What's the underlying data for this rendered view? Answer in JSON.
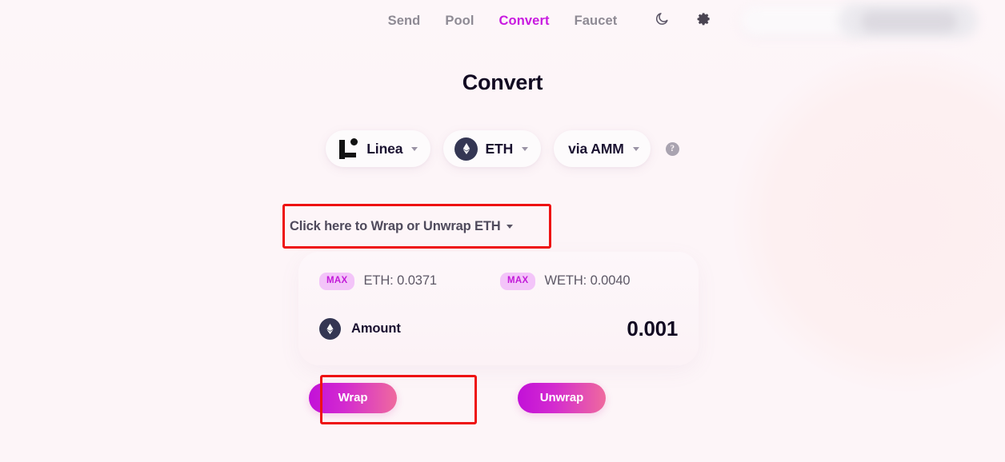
{
  "nav": {
    "items": [
      {
        "label": "Send",
        "active": false
      },
      {
        "label": "Pool",
        "active": false
      },
      {
        "label": "Convert",
        "active": true
      },
      {
        "label": "Faucet",
        "active": false
      }
    ],
    "dark_mode_icon": "moon-icon",
    "settings_icon": "gear-icon"
  },
  "header": {
    "title": "Convert"
  },
  "selectors": {
    "chain": {
      "label": "Linea",
      "icon": "linea-logo-icon",
      "caret": "chevron-down-icon"
    },
    "token": {
      "label": "ETH",
      "icon": "ethereum-icon",
      "caret": "chevron-down-icon"
    },
    "route": {
      "label": "via AMM",
      "caret": "chevron-down-icon"
    },
    "help": {
      "glyph": "?",
      "name": "help-icon"
    }
  },
  "wrap_dropdown": {
    "label": "Click here to Wrap or Unwrap ETH",
    "caret": "▾"
  },
  "balances": [
    {
      "max_label": "MAX",
      "text": "ETH: 0.0371"
    },
    {
      "max_label": "MAX",
      "text": "WETH: 0.0040"
    }
  ],
  "amount": {
    "icon": "ethereum-icon",
    "label": "Amount",
    "value": "0.001"
  },
  "actions": {
    "wrap_label": "Wrap",
    "unwrap_label": "Unwrap"
  },
  "colors": {
    "accent": "#c81ae0",
    "button_gradient_start": "#c211d8",
    "button_gradient_end": "#ef6a9e",
    "background": "#fdf5f8",
    "annotation": "#ee1111",
    "text_dark": "#120a22",
    "text_muted": "#8e8a94",
    "max_badge_bg": "#f3c4f9"
  }
}
